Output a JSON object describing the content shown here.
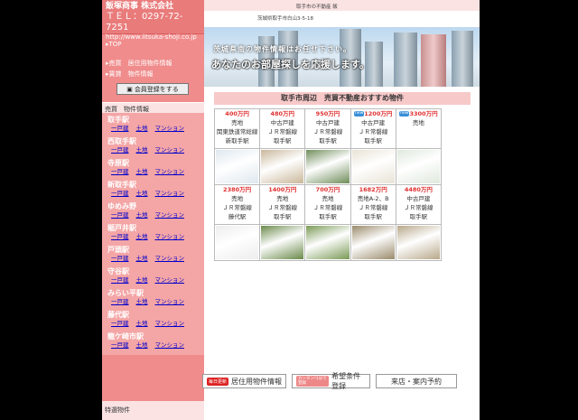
{
  "brand": {
    "name": "飯塚商事 株式会社",
    "tel": "ＴＥＬ：0297-72-7251",
    "url": "http://www.iitsuka-shoji.co.jp"
  },
  "header": {
    "address": "茨城県取手市白山3-5-18",
    "toplink": "取手市の不動産 飯",
    "hero_line1": "茨城県南の物件情報はお任せ下さい。",
    "hero_line2": "あなたのお部屋探しを応援します。"
  },
  "sidebar": {
    "top": "▸TOP",
    "buy_info": "▸売買　居住用物件情報",
    "lease_info": "▸賃貸　物件情報",
    "register": "会員登録をする",
    "section": "売買　物件情報",
    "link_labels": [
      "一戸建",
      "土地",
      "マンション"
    ],
    "stations": [
      "取手駅",
      "西取手駅",
      "寺原駅",
      "新取手駅",
      "ゆめみ野",
      "稲戸井駅",
      "戸頭駅",
      "守谷駅",
      "みらい平駅",
      "藤代駅",
      "龍ケ崎市駅"
    ],
    "featured": "特選物件"
  },
  "listings": {
    "band": "取手市周辺　売買不動産おすすめ物件",
    "new_badge": "new",
    "row1": [
      {
        "price": "400万円",
        "lines": [
          "売地",
          "関東鉄道常総線",
          "新取手駅"
        ],
        "is_new": false
      },
      {
        "price": "480万円",
        "lines": [
          "中古戸建",
          "ＪＲ常磐線",
          "取手駅"
        ],
        "is_new": false
      },
      {
        "price": "950万円",
        "lines": [
          "中古戸建",
          "ＪＲ常磐線",
          "取手駅"
        ],
        "is_new": false
      },
      {
        "price": "1200万円",
        "lines": [
          "中古戸建",
          "ＪＲ常磐線",
          "取手駅"
        ],
        "is_new": true
      },
      {
        "price": "3300万円",
        "lines": [
          "売地"
        ],
        "is_new": true
      }
    ],
    "row2": [
      {
        "price": "2380万円",
        "lines": [
          "売地",
          "ＪＲ常磐線",
          "藤代駅"
        ],
        "is_new": false
      },
      {
        "price": "1400万円",
        "lines": [
          "売地",
          "ＪＲ常磐線",
          "取手駅"
        ],
        "is_new": false
      },
      {
        "price": "700万円",
        "lines": [
          "売地",
          "ＪＲ常磐線",
          "取手駅"
        ],
        "is_new": false
      },
      {
        "price": "1682万円",
        "lines": [
          "売地A-2、B",
          "ＪＲ常磐線",
          "取手駅"
        ],
        "is_new": false
      },
      {
        "price": "4480万円",
        "lines": [
          "中古戸建",
          "ＪＲ常磐線",
          "取手駅"
        ],
        "is_new": false
      }
    ]
  },
  "bottom": {
    "daily_tag": "毎日更新",
    "daily_label": "居住用物件情報",
    "req_tag": "カンタン!1分で登録",
    "req_label": "希望条件登録",
    "visit_label": "来店・案内予約"
  },
  "thumb_colors": [
    "#dfe8ef",
    "#c9b79a",
    "#6f8d5a",
    "#e9e3d6",
    "#dfe9dd",
    "#ededed",
    "#6a8a4a",
    "#7a9a55",
    "#9a8a6a",
    "#b8a88a"
  ]
}
